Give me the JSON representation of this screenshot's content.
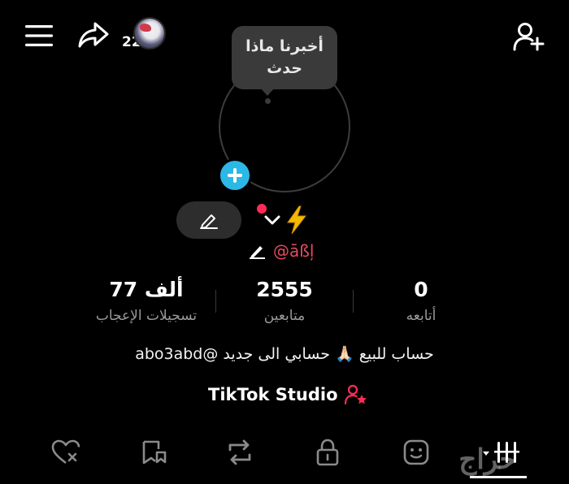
{
  "header": {
    "story_count": "22",
    "menu_icon": "hamburger-menu-icon",
    "share_icon": "share-arrow-icon",
    "add_user_icon": "add-user-icon"
  },
  "tooltip": {
    "line1": "أخبرنا ماذا",
    "line2": "حدث"
  },
  "profile": {
    "username": "@āßļ",
    "accent_color": "#fe2c55",
    "add_button_color": "#2cb8e6"
  },
  "stats": {
    "likes": {
      "value": "77 ألف",
      "label": "تسجيلات الإعجاب"
    },
    "followers": {
      "value": "2555",
      "label": "متابعين"
    },
    "following": {
      "value": "0",
      "label": "أتابعه"
    }
  },
  "bio": {
    "text": "حساب للبيع 🙏🏻 حسابي الى جديد @abo3abd"
  },
  "studio": {
    "label": "TikTok Studio"
  },
  "tabs": [
    {
      "icon": "liked-heart-icon"
    },
    {
      "icon": "favorites-bookmark-icon"
    },
    {
      "icon": "repost-icon"
    },
    {
      "icon": "private-lock-icon"
    },
    {
      "icon": "shop-face-icon"
    },
    {
      "icon": "videos-grid-icon"
    }
  ],
  "watermark": "حراج"
}
